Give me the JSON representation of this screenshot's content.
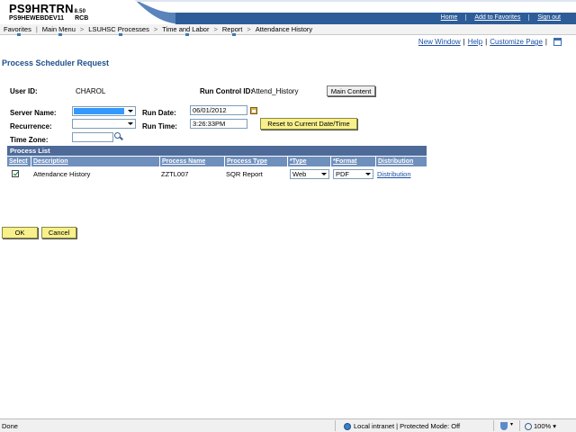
{
  "banner": {
    "title": "PS9HRTRN",
    "version": "8.50",
    "database": "PS9HEWEBDEV11",
    "user_code": "RCB",
    "links": [
      "Home",
      "Add to Favorites",
      "Sign out"
    ]
  },
  "nav": {
    "items": [
      "Favorites",
      "Main Menu",
      "LSUHSC Processes",
      "Time and Labor",
      "Report",
      "Attendance History"
    ],
    "separator": "|",
    "breadcrumb_separator": ">"
  },
  "sublinks": {
    "new_window": "New Window",
    "help": "Help",
    "customize_page": "Customize Page",
    "separator": "|"
  },
  "page": {
    "title": "Process Scheduler Request"
  },
  "form": {
    "user_id_label": "User ID:",
    "user_id_value": "CHAROL",
    "run_control_label": "Run Control ID:",
    "run_control_value": "Attend_History",
    "main_content_button": "Main Content",
    "server_name_label": "Server Name:",
    "server_name_value": "",
    "run_date_label": "Run Date:",
    "run_date_value": "06/01/2012",
    "recurrence_label": "Recurrence:",
    "recurrence_value": "",
    "run_time_label": "Run Time:",
    "run_time_value": "3:26:33PM",
    "reset_button": "Reset to Current Date/Time",
    "time_zone_label": "Time Zone:",
    "time_zone_value": ""
  },
  "process_list": {
    "title": "Process List",
    "columns": [
      "Select",
      "Description",
      "Process Name",
      "Process Type",
      "*Type",
      "*Format",
      "Distribution"
    ],
    "rows": [
      {
        "selected": true,
        "description": "Attendance History",
        "process_name": "ZZTL007",
        "process_type": "SQR Report",
        "type": "Web",
        "format": "PDF",
        "distribution": "Distribution"
      }
    ]
  },
  "actions": {
    "ok": "OK",
    "cancel": "Cancel"
  },
  "statusbar": {
    "status": "Done",
    "zone": "Local intranet | Protected Mode: Off",
    "zoom": "100%"
  },
  "colors": {
    "banner_blue": "#1f4f8c",
    "grid_header": "#4d6a98",
    "grid_columns": "#6f8fbd",
    "yellow_button": "#f7f08c",
    "link": "#1a4fa3"
  }
}
